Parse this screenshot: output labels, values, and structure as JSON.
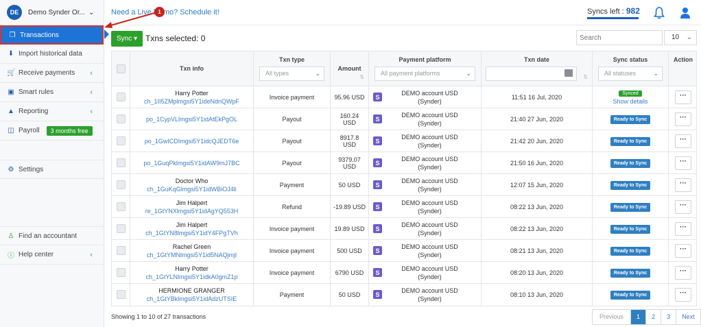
{
  "org": {
    "initials": "DE",
    "name": "Demo Synder Or..."
  },
  "sidebar": {
    "items": [
      {
        "label": "Transactions",
        "icon": "copy-icon",
        "active": true
      },
      {
        "label": "Import historical data",
        "icon": "download-icon"
      },
      {
        "label": "Receive payments",
        "icon": "cart-icon",
        "caret": "‹"
      },
      {
        "label": "Smart rules",
        "icon": "sitemap-icon",
        "caret": "‹"
      },
      {
        "label": "Reporting",
        "icon": "area-chart-icon",
        "caret": "‹"
      },
      {
        "label": "Payroll",
        "icon": "payroll-icon",
        "badge": "3 months free"
      },
      {
        "label": "Settings",
        "icon": "gear-icon"
      },
      {
        "label": "Find an accountant",
        "icon": "accountant-icon"
      },
      {
        "label": "Help center",
        "icon": "question-icon",
        "caret": "‹"
      }
    ]
  },
  "header": {
    "live_demo": "Need a Live Demo? Schedule it!",
    "syncs_left_label": "Syncs left :",
    "syncs_left_value": "982"
  },
  "annotation": {
    "number": "1"
  },
  "toolbar": {
    "sync_label": "Sync ▾",
    "txns_selected": "Txns selected: 0",
    "search_placeholder": "Search",
    "page_size": "10"
  },
  "table": {
    "headers": {
      "txn_info": "Txn info",
      "txn_type": "Txn type",
      "amount": "Amount",
      "payment_platform": "Payment platform",
      "txn_date": "Txn date",
      "sync_status": "Sync status",
      "action": "Action"
    },
    "filters": {
      "txn_type": "All types",
      "payment_platform": "All payment platforms",
      "sync_status": "All statuses"
    },
    "rows": [
      {
        "name": "Harry Potter",
        "id": "ch_1II5ZMplmgsi5Y1ideNdnQWpF",
        "type": "Invoice payment",
        "amount": "95.96 USD",
        "platform_line1": "DEMO account USD",
        "platform_line2": "(Synder)",
        "date": "11:51 16 Jul, 2020",
        "status": "Synced",
        "status_link": "Show details"
      },
      {
        "name": "",
        "id": "po_1CypVLlmgsi5Y1idAtEkPgOL",
        "type": "Payout",
        "amount": "160.24 USD",
        "platform_line1": "DEMO account USD",
        "platform_line2": "(Synder)",
        "date": "21:40 27 Jun, 2020",
        "status": "Ready to Sync"
      },
      {
        "name": "",
        "id": "po_1GwICDImgsi5Y1idcQJEDT6e",
        "type": "Payout",
        "amount": "8917.8 USD",
        "platform_line1": "DEMO account USD",
        "platform_line2": "(Synder)",
        "date": "21:42 20 Jun, 2020",
        "status": "Ready to Sync"
      },
      {
        "name": "",
        "id": "po_1GuqPklmgsi5Y1idAW9mJ7BC",
        "type": "Payout",
        "amount": "9379.07 USD",
        "platform_line1": "DEMO account USD",
        "platform_line2": "(Synder)",
        "date": "21:50 16 Jun, 2020",
        "status": "Ready to Sync"
      },
      {
        "name": "Doctor Who",
        "id": "ch_1GuKqGlmgsi5Y1idWBiOJ4li",
        "type": "Payment",
        "amount": "50 USD",
        "platform_line1": "DEMO account USD",
        "platform_line2": "(Synder)",
        "date": "12:07 15 Jun, 2020",
        "status": "Ready to Sync"
      },
      {
        "name": "Jim Halpert",
        "id": "re_1GtYNXlmgsi5Y1idAgYQ553H",
        "type": "Refund",
        "amount": "-19.89 USD",
        "platform_line1": "DEMO account USD",
        "platform_line2": "(Synder)",
        "date": "08:22 13 Jun, 2020",
        "status": "Ready to Sync"
      },
      {
        "name": "Jim Halpert",
        "id": "ch_1GtYN8lmgsi5Y1idY4FPgTVh",
        "type": "Invoice payment",
        "amount": "19.89 USD",
        "platform_line1": "DEMO account USD",
        "platform_line2": "(Synder)",
        "date": "08:22 13 Jun, 2020",
        "status": "Ready to Sync"
      },
      {
        "name": "Rachel Green",
        "id": "ch_1GtYMNlmgsi5Y1id5NAQjmjl",
        "type": "Invoice payment",
        "amount": "500 USD",
        "platform_line1": "DEMO account USD",
        "platform_line2": "(Synder)",
        "date": "08:21 13 Jun, 2020",
        "status": "Ready to Sync"
      },
      {
        "name": "Harry Potter",
        "id": "ch_1GtYLNlmgsi5Y1idkA0gmZ1p",
        "type": "Invoice payment",
        "amount": "6790 USD",
        "platform_line1": "DEMO account USD",
        "platform_line2": "(Synder)",
        "date": "08:20 13 Jun, 2020",
        "status": "Ready to Sync"
      },
      {
        "name": "HERMIONE GRANGER",
        "id": "ch_1GtYBklmgsi5Y1idAdzUTSIE",
        "type": "Payment",
        "amount": "50 USD",
        "platform_line1": "DEMO account USD",
        "platform_line2": "(Synder)",
        "date": "08:10 13 Jun, 2020",
        "status": "Ready to Sync"
      }
    ]
  },
  "footer": {
    "showing": "Showing 1 to 10 of 27 transactions",
    "pages": [
      "Previous",
      "1",
      "2",
      "3",
      "Next"
    ]
  },
  "colors": {
    "brand_blue": "#1d73d6",
    "green": "#2ca02c",
    "ready_blue": "#2f7fc1",
    "annotation_red": "#c8241c"
  }
}
